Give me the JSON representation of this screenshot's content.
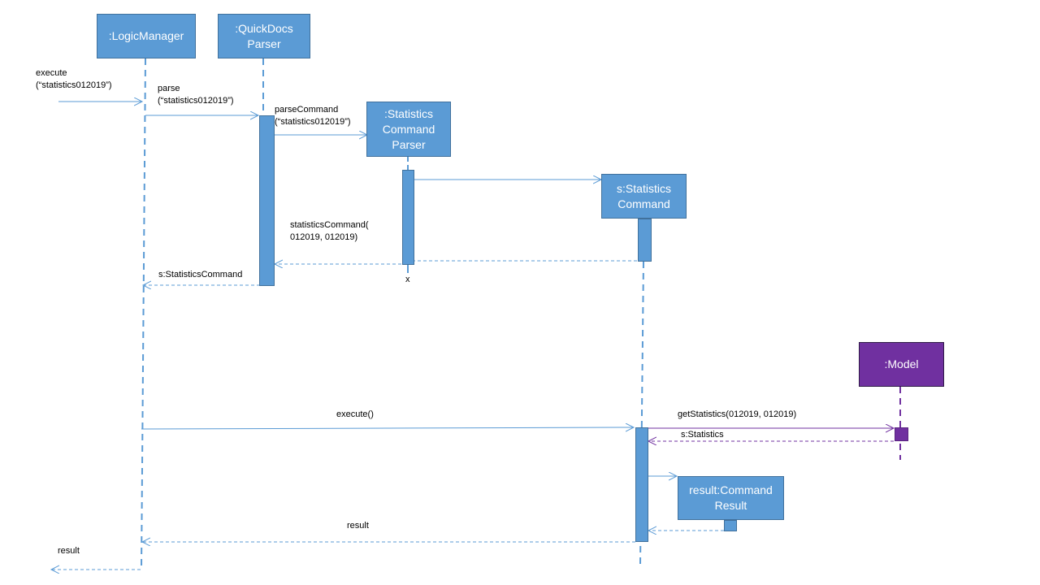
{
  "diagram": {
    "type": "UML sequence diagram",
    "colors": {
      "participant": "#5b9bd5",
      "participant_border": "#41719c",
      "model": "#7030a0",
      "message_line": "#5b9bd5",
      "model_message_line": "#7030a0"
    },
    "participants": {
      "logic_manager": ":LogicManager",
      "quickdocs_parser": ":QuickDocs\nParser",
      "statistics_command_parser": ":Statistics\nCommand\nParser",
      "statistics_command": "s:Statistics\nCommand",
      "model": ":Model",
      "command_result": "result:Command\nResult"
    },
    "messages": {
      "execute_input": "execute\n(“statistics012019”)",
      "parse": "parse\n(“statistics012019”)",
      "parse_command": "parseCommand\n(“statistics012019”)",
      "statistics_command_ctor": "statisticsCommand(\n012019, 012019)",
      "return_statistics_command": "s:StatisticsCommand",
      "destroy_marker": "x",
      "execute": "execute()",
      "get_statistics": "getStatistics(012019, 012019)",
      "return_statistics": "s:Statistics",
      "return_result_inner": "result",
      "return_result_outer": "result"
    }
  }
}
